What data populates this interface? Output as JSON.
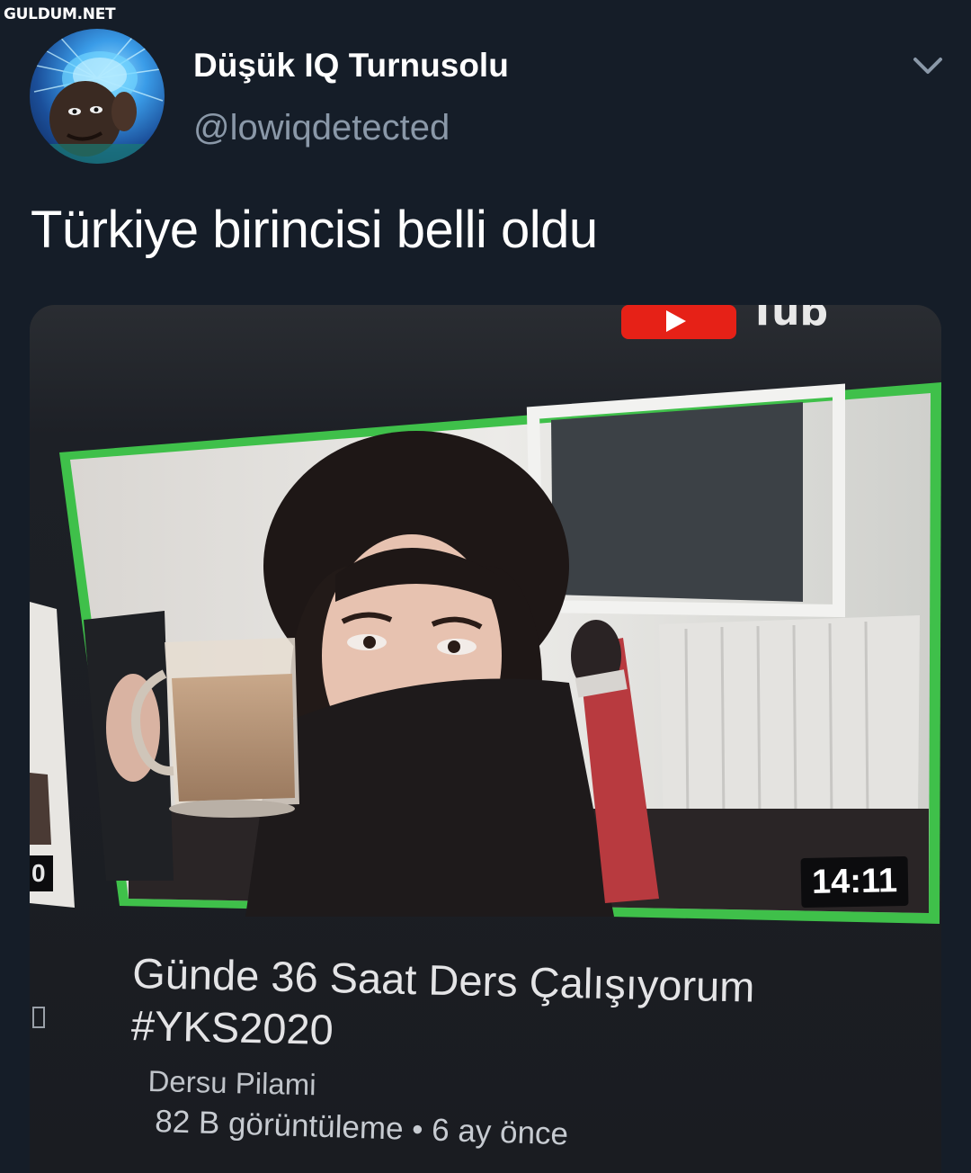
{
  "watermark": "GULDUM.NET",
  "tweet": {
    "author_name": "Düşük IQ Turnusolu",
    "author_handle": "@lowiqdetected",
    "text": "Türkiye birincisi belli oldu",
    "avatar_icon": "galaxy-brain-avatar",
    "menu_icon": "chevron-down-icon"
  },
  "media": {
    "video": {
      "duration": "14:11",
      "side_duration": "0",
      "title_line1": "Günde 36 Saat Ders Çalışıyorum",
      "title_line2": "#YKS2020",
      "channel": "Dersu Pilami",
      "views": "82 B görüntüleme",
      "separator": "•",
      "age": "6 ay önce"
    },
    "colors": {
      "highlight_border": "#3fc04a",
      "youtube_red": "#e62117"
    }
  }
}
